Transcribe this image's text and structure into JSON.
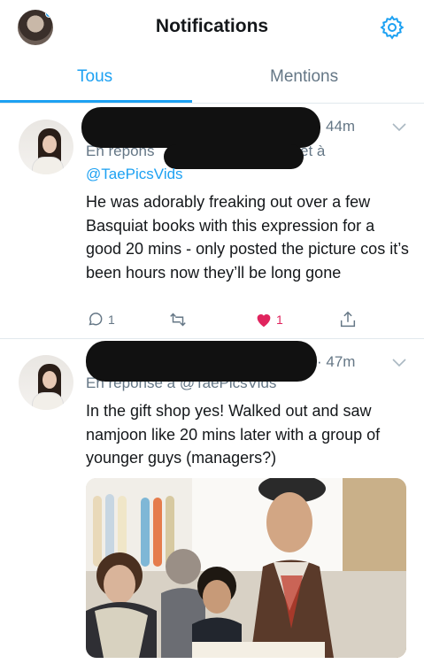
{
  "header": {
    "title": "Notifications",
    "accent": "#1da1f2"
  },
  "tabs": [
    {
      "label": "Tous",
      "active": true
    },
    {
      "label": "Mentions",
      "active": false
    }
  ],
  "tweets": [
    {
      "time": "44m",
      "reply_prefix": "En répons",
      "reply_suffix": "et à",
      "handle": "@TaePicsVids",
      "text": "He was adorably freaking out over a few Basquiat books with this expression for a good 20 mins - only posted the picture cos it’s been hours now they’ll be long gone",
      "reply_count": "1",
      "like_count": "1",
      "liked": true
    },
    {
      "time": "· 47m",
      "reply_prefix": "En réponse à @TaePicsVids",
      "text": "In the gift shop yes! Walked out and saw namjoon like 20 mins later with a group of younger guys (managers?)"
    }
  ],
  "colors": {
    "like": "#e0245e",
    "muted": "#657786",
    "divider": "#e1e8ed"
  }
}
